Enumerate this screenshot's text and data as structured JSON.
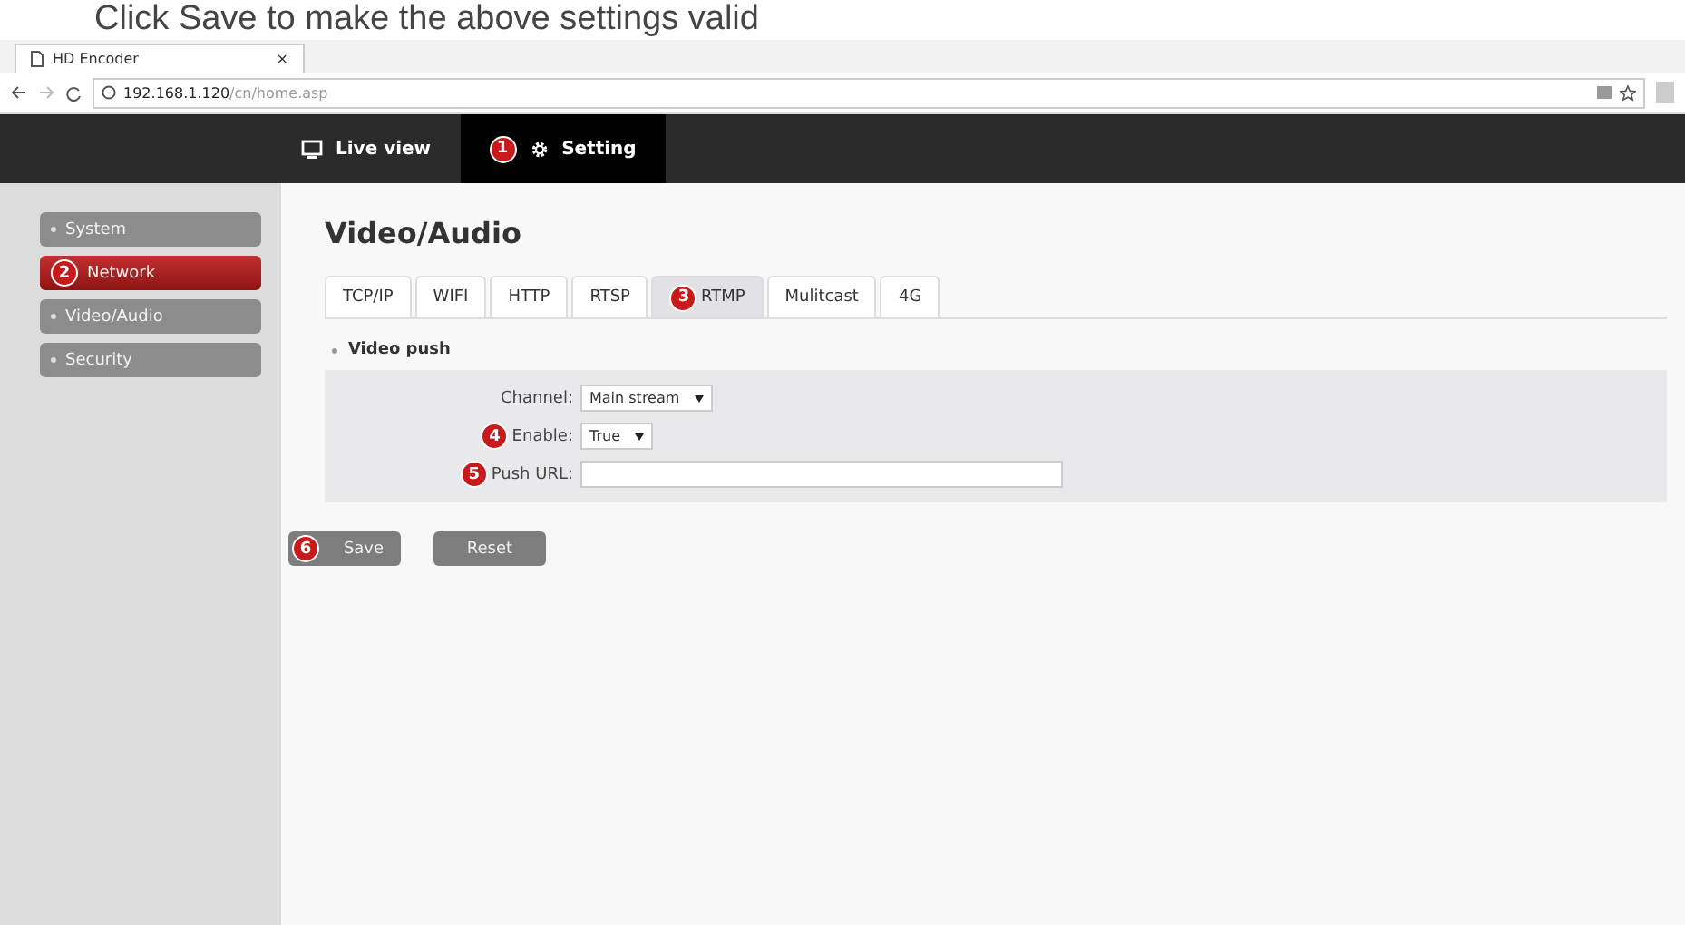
{
  "caption": "Click Save to make the above settings valid",
  "browser": {
    "tab_title": "HD Encoder",
    "tab_close": "×",
    "url_host": "192.168.1.120",
    "url_path": "/cn/home.asp"
  },
  "nav": [
    {
      "label": "Live view",
      "kind": "monitor",
      "selected": false
    },
    {
      "label": "Setting",
      "kind": "gear",
      "selected": true,
      "badge": "1"
    }
  ],
  "sidebar": {
    "items": [
      {
        "label": "System",
        "selected": false
      },
      {
        "label": "Network",
        "selected": true,
        "badge": "2"
      },
      {
        "label": "Video/Audio",
        "selected": false
      },
      {
        "label": "Security",
        "selected": false
      }
    ]
  },
  "page_title": "Video/Audio",
  "tabs": [
    {
      "label": "TCP/IP",
      "selected": false
    },
    {
      "label": "WIFI",
      "selected": false
    },
    {
      "label": "HTTP",
      "selected": false
    },
    {
      "label": "RTSP",
      "selected": false
    },
    {
      "label": "RTMP",
      "selected": true,
      "badge": "3"
    },
    {
      "label": "Mulitcast",
      "selected": false
    },
    {
      "label": "4G",
      "selected": false
    }
  ],
  "section_title": "Video push",
  "form": [
    {
      "label": "Channel:",
      "kind": "select",
      "value": "Main stream"
    },
    {
      "label": "Enable:",
      "kind": "select",
      "value": "True",
      "badge": "4"
    },
    {
      "label": "Push URL:",
      "kind": "text",
      "badge": "5"
    }
  ],
  "buttons": [
    {
      "label": "Save",
      "badge": "6"
    },
    {
      "label": "Reset"
    }
  ]
}
